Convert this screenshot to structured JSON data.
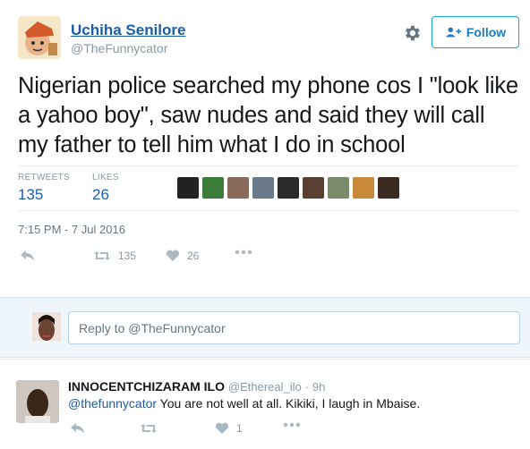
{
  "author": {
    "name": "Uchiha Senilore",
    "handle": "@TheFunnycator"
  },
  "follow_label": "Follow",
  "tweet_text": "Nigerian police searched my phone cos I \"look like a yahoo boy\", saw nudes and said they will call my father to tell him what I do in school",
  "stats": {
    "retweets_label": "RETWEETS",
    "retweets_value": "135",
    "likes_label": "LIKES",
    "likes_value": "26"
  },
  "likers_colors": [
    "#222222",
    "#3a7d3a",
    "#8a6a5a",
    "#6b7a8a",
    "#2a2a2a",
    "#5a4030",
    "#7a8a6a",
    "#c98a3a",
    "#3a2a20"
  ],
  "timestamp": "7:15 PM - 7 Jul 2016",
  "actions": {
    "retweet_count": "135",
    "like_count": "26"
  },
  "reply_box": {
    "placeholder": "Reply to @TheFunnycator"
  },
  "reply": {
    "name": "INNOCENTCHIZARAM ILO",
    "handle": "@Ethereal_ilo",
    "separator": "·",
    "time": "9h",
    "mention": "@thefunnycator",
    "text": " You are not well at all. Kikiki, I laugh in Mbaise.",
    "like_count": "1"
  },
  "colors": {
    "link": "#1b5da8",
    "muted": "#8899a6",
    "follow_border": "#1da1f2"
  }
}
